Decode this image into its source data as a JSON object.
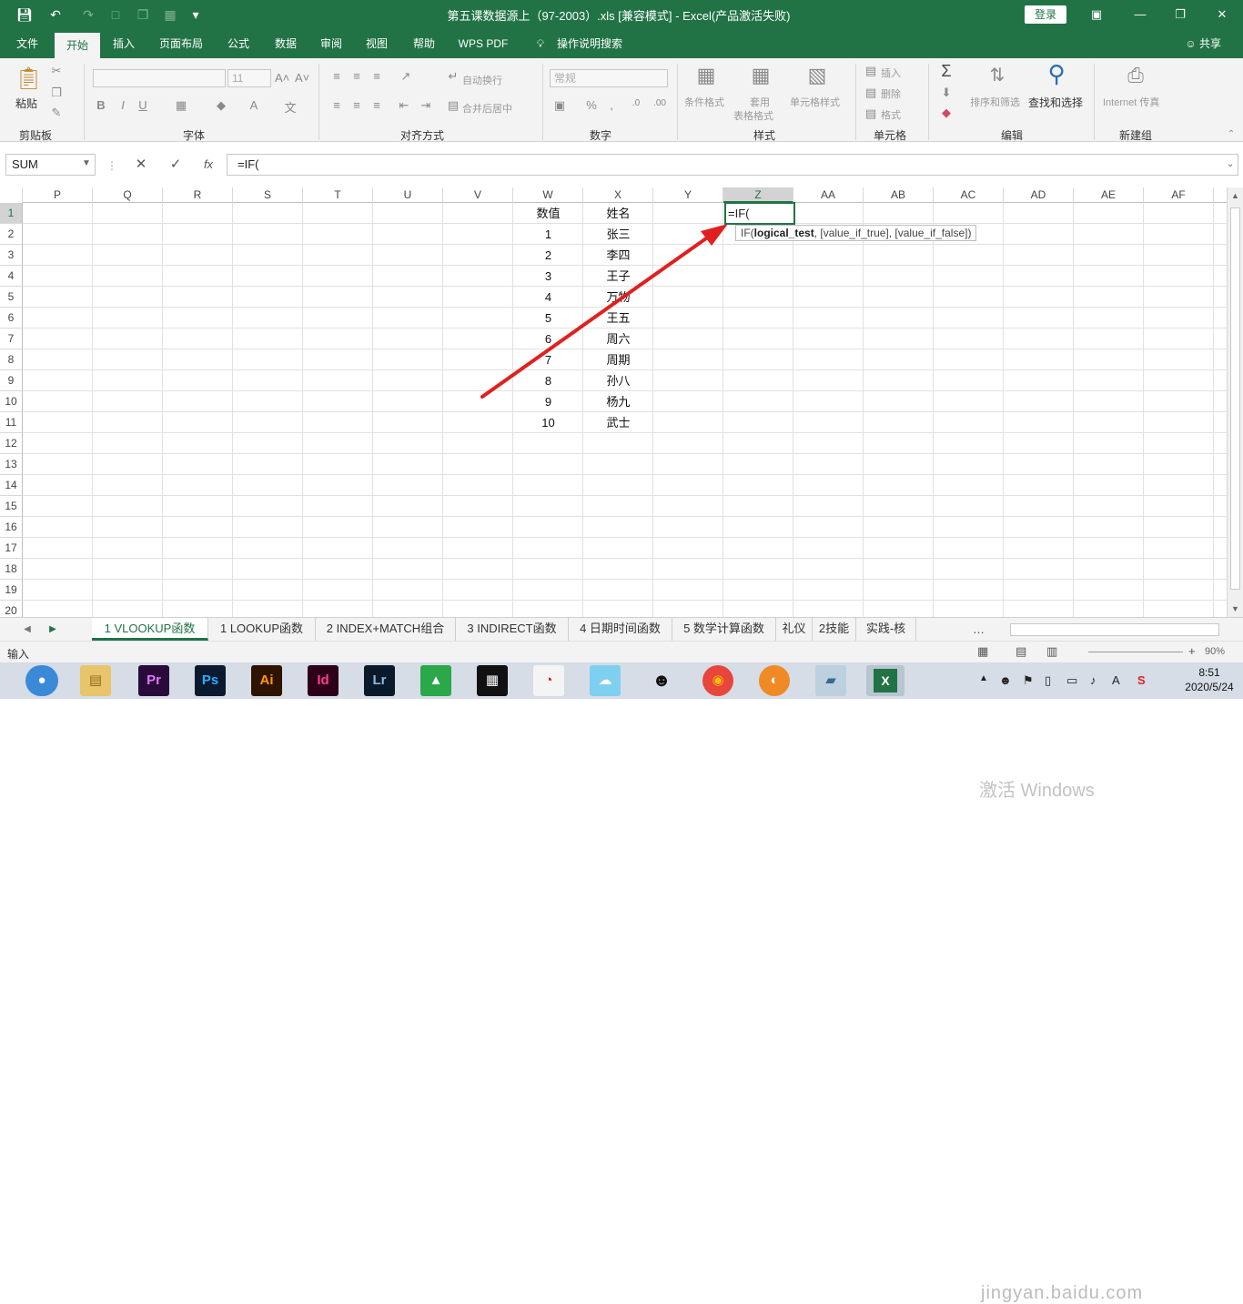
{
  "title_bar": {
    "title": "第五课数据源上（97-2003）.xls  [兼容模式]  -  Excel(产品激活失败)",
    "login": "登录"
  },
  "ribbon_tabs": [
    "文件",
    "开始",
    "插入",
    "页面布局",
    "公式",
    "数据",
    "审阅",
    "视图",
    "帮助",
    "WPS PDF",
    "操作说明搜索"
  ],
  "share": "共享",
  "ribbon": {
    "clipboard": {
      "paste": "粘贴",
      "label": "剪贴板"
    },
    "font": {
      "name": "",
      "size": "11",
      "label": "字体"
    },
    "alignment": {
      "wrap": "自动换行",
      "merge": "合并后居中",
      "label": "对齐方式"
    },
    "number": {
      "format": "常规",
      "label": "数字"
    },
    "styles": {
      "cond": "条件格式",
      "table1": "套用",
      "table2": "表格格式",
      "cell": "单元格样式",
      "label": "样式"
    },
    "cells": {
      "insert": "插入",
      "delete": "删除",
      "format": "格式",
      "label": "单元格"
    },
    "editing": {
      "sort": "排序和筛选",
      "find": "查找和选择",
      "label": "编辑"
    },
    "newgroup": {
      "internet": "Internet 传真",
      "label": "新建组"
    }
  },
  "formula_bar": {
    "name_box": "SUM",
    "fx": "fx",
    "formula": "=IF("
  },
  "columns": [
    "P",
    "Q",
    "R",
    "S",
    "T",
    "U",
    "V",
    "W",
    "X",
    "Y",
    "Z",
    "AA",
    "AB",
    "AC",
    "AD",
    "AE",
    "AF"
  ],
  "selected_column": "Z",
  "rows": [
    "1",
    "2",
    "3",
    "4",
    "5",
    "6",
    "7",
    "8",
    "9",
    "10",
    "11",
    "12",
    "13",
    "14",
    "15",
    "16",
    "17",
    "18",
    "19",
    "20"
  ],
  "table": {
    "headers": [
      "数值",
      "姓名"
    ],
    "rows": [
      [
        "1",
        "张三"
      ],
      [
        "2",
        "李四"
      ],
      [
        "3",
        "王子"
      ],
      [
        "4",
        "万物"
      ],
      [
        "5",
        "王五"
      ],
      [
        "6",
        "周六"
      ],
      [
        "7",
        "周期"
      ],
      [
        "8",
        "孙八"
      ],
      [
        "9",
        "杨九"
      ],
      [
        "10",
        "武士"
      ]
    ]
  },
  "active_cell": {
    "content": "=IF("
  },
  "tooltip": {
    "fn": "IF(",
    "arg1": "logical_test",
    "rest": ", [value_if_true], [value_if_false])"
  },
  "sheet_tabs": [
    "1 VLOOKUP函数",
    "1 LOOKUP函数",
    "2 INDEX+MATCH组合",
    "3 INDIRECT函数",
    "4 日期时间函数",
    "5 数学计算函数",
    "礼仪",
    "2技能",
    "实践-核"
  ],
  "status": {
    "mode": "输入",
    "zoom": "90%"
  },
  "taskbar": {
    "apps": [
      "Pr",
      "Ps",
      "Ai",
      "Id",
      "Lr"
    ],
    "time": "8:51",
    "date": "2020/5/24"
  },
  "watermark": {
    "line1": "激活 Windows",
    "line2": "jingyan.baidu.com"
  },
  "colors": {
    "accent": "#217346",
    "arrow": "#e02020"
  }
}
